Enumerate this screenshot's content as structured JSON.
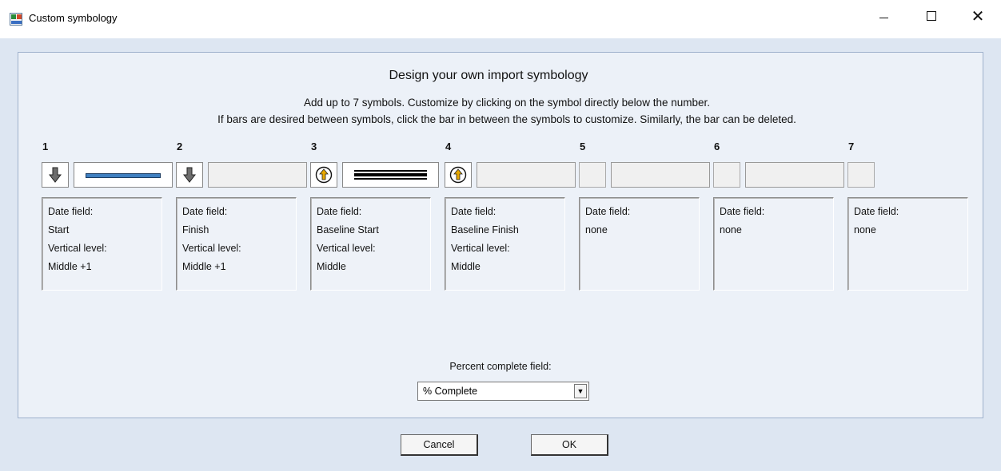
{
  "window": {
    "title": "Custom symbology",
    "minimize_label": "—",
    "maximize_label": "□",
    "close_label": "✕"
  },
  "main": {
    "heading": "Design your own import symbology",
    "instruction_1": "Add up to 7 symbols.  Customize by clicking on the symbol directly below the number.",
    "instruction_2": "If bars are desired between symbols, click the bar in between the symbols to customize.  Similarly, the bar can be deleted."
  },
  "slots": [
    {
      "number": "1",
      "symbol": "down-arrow-icon",
      "bar": "blue-bar",
      "field_label": "Date field:",
      "field_value": "Start",
      "level_label": "Vertical level:",
      "level_value": "Middle +1"
    },
    {
      "number": "2",
      "symbol": "down-arrow-icon",
      "bar": "none",
      "field_label": "Date field:",
      "field_value": "Finish",
      "level_label": "Vertical level:",
      "level_value": "Middle +1"
    },
    {
      "number": "3",
      "symbol": "up-arrow-circle-icon",
      "bar": "black-bar",
      "field_label": "Date field:",
      "field_value": "Baseline Start",
      "level_label": "Vertical level:",
      "level_value": "Middle"
    },
    {
      "number": "4",
      "symbol": "up-arrow-circle-icon",
      "bar": "none",
      "field_label": "Date field:",
      "field_value": "Baseline Finish",
      "level_label": "Vertical level:",
      "level_value": "Middle"
    },
    {
      "number": "5",
      "symbol": "none",
      "bar": "none",
      "field_label": "Date field:",
      "field_value": "none"
    },
    {
      "number": "6",
      "symbol": "none",
      "bar": "none",
      "field_label": "Date field:",
      "field_value": "none"
    },
    {
      "number": "7",
      "symbol": "none",
      "field_label": "Date field:",
      "field_value": "none"
    }
  ],
  "percent_complete": {
    "label": "Percent complete field:",
    "value": "% Complete"
  },
  "buttons": {
    "cancel": "Cancel",
    "ok": "OK"
  },
  "colors": {
    "background": "#dde6f2",
    "panel": "#ecf1f8",
    "bar_blue": "#3f7fc0",
    "arrow_gold": "#e8a800"
  }
}
